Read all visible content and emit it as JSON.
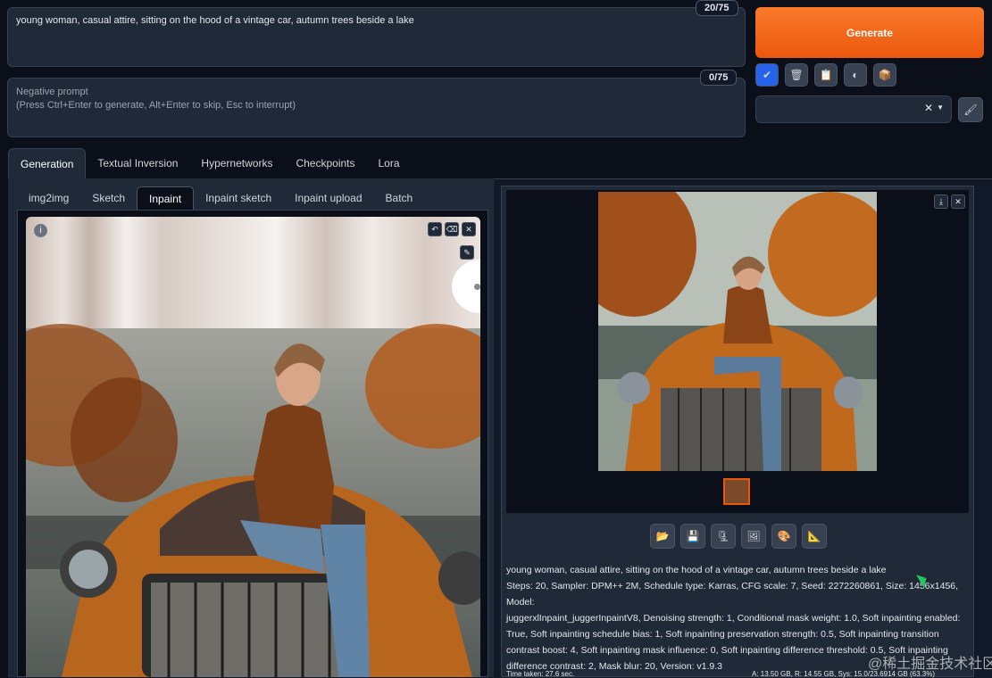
{
  "prompt": {
    "text": "young woman, casual attire, sitting on the hood of a vintage car, autumn trees beside a lake",
    "counter": "20/75"
  },
  "negative_prompt": {
    "placeholder_line1": "Negative prompt",
    "placeholder_line2": "(Press Ctrl+Enter to generate, Alt+Enter to skip, Esc to interrupt)",
    "counter": "0/75"
  },
  "generate_label": "Generate",
  "main_tabs": [
    "Generation",
    "Textual Inversion",
    "Hypernetworks",
    "Checkpoints",
    "Lora"
  ],
  "sub_tabs": [
    "img2img",
    "Sketch",
    "Inpaint",
    "Inpaint sketch",
    "Inpaint upload",
    "Batch"
  ],
  "accent_color": "#ea580c",
  "info": {
    "line1": "young woman, casual attire, sitting on the hood of a vintage car, autumn trees beside a lake",
    "line2": "Steps: 20, Sampler: DPM++ 2M, Schedule type: Karras, CFG scale: 7, Seed: 2272260861, Size: 1456x1456, Model:",
    "line3": "juggerxlInpaint_juggerInpaintV8, Denoising strength: 1, Conditional mask weight: 1.0, Soft inpainting enabled:",
    "line4": "True, Soft inpainting schedule bias: 1, Soft inpainting preservation strength: 0.5, Soft inpainting transition",
    "line5": "contrast boost: 4, Soft inpainting mask influence: 0, Soft inpainting difference threshold: 0.5, Soft inpainting",
    "line6": "difference contrast: 2, Mask blur: 20, Version: v1.9.3",
    "time_taken": "Time taken: 27.6 sec.",
    "memory": "A: 13.50 GB, R: 14.55 GB, Sys: 15.0/23.6914 GB (63.3%)"
  },
  "watermark": "@稀土掘金技术社区"
}
